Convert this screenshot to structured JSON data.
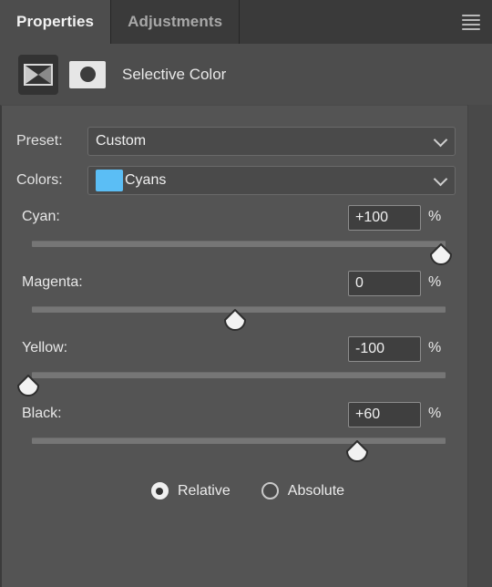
{
  "tabs": [
    {
      "label": "Properties",
      "active": true
    },
    {
      "label": "Adjustments",
      "active": false
    }
  ],
  "menu_icon": "hamburger-menu-icon",
  "header": {
    "adjustment_icon": "selective-color-icon",
    "mask_icon": "layer-mask-thumbnail-icon",
    "title": "Selective Color"
  },
  "preset": {
    "label": "Preset:",
    "value": "Custom",
    "chevron_icon": "chevron-down-icon"
  },
  "colors": {
    "label": "Colors:",
    "value": "Cyans",
    "swatch_color": "#5bbef5",
    "chevron_icon": "chevron-down-icon"
  },
  "sliders": [
    {
      "label": "Cyan:",
      "value": "+100",
      "unit": "%",
      "percent": 100
    },
    {
      "label": "Magenta:",
      "value": "0",
      "unit": "%",
      "percent": 50
    },
    {
      "label": "Yellow:",
      "value": "-100",
      "unit": "%",
      "percent": 0
    },
    {
      "label": "Black:",
      "value": "+60",
      "unit": "%",
      "percent": 80
    }
  ],
  "method": {
    "options": [
      {
        "label": "Relative",
        "selected": true
      },
      {
        "label": "Absolute",
        "selected": false
      }
    ]
  },
  "theme": {
    "panel_bg": "#545454",
    "tabbar_bg": "#2b2b2b",
    "active_tab_bg": "#4d4d4d",
    "accent": "#5bbef5"
  }
}
